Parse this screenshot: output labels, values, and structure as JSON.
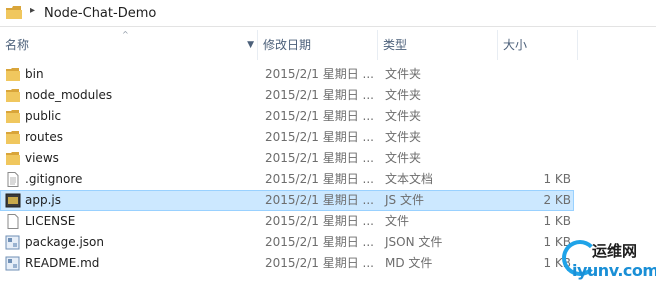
{
  "address": {
    "separator": "▸",
    "crumb": "Node-Chat-Demo"
  },
  "columns": {
    "name": "名称",
    "date": "修改日期",
    "type": "类型",
    "size": "大小",
    "sort_arrow": "^",
    "dropdown_arrow": "▼"
  },
  "files": [
    {
      "name": "bin",
      "date": "2015/2/1 星期日 ...",
      "type": "文件夹",
      "size": "",
      "icon": "folder-icon"
    },
    {
      "name": "node_modules",
      "date": "2015/2/1 星期日 ...",
      "type": "文件夹",
      "size": "",
      "icon": "folder-icon"
    },
    {
      "name": "public",
      "date": "2015/2/1 星期日 ...",
      "type": "文件夹",
      "size": "",
      "icon": "folder-icon"
    },
    {
      "name": "routes",
      "date": "2015/2/1 星期日 ...",
      "type": "文件夹",
      "size": "",
      "icon": "folder-icon"
    },
    {
      "name": "views",
      "date": "2015/2/1 星期日 ...",
      "type": "文件夹",
      "size": "",
      "icon": "folder-icon"
    },
    {
      "name": ".gitignore",
      "date": "2015/2/1 星期日 ...",
      "type": "文本文档",
      "size": "1 KB",
      "icon": "text-file-icon"
    },
    {
      "name": "app.js",
      "date": "2015/2/1 星期日 ...",
      "type": "JS 文件",
      "size": "2 KB",
      "icon": "script-file-icon",
      "selected": true
    },
    {
      "name": "LICENSE",
      "date": "2015/2/1 星期日 ...",
      "type": "文件",
      "size": "1 KB",
      "icon": "blank-file-icon"
    },
    {
      "name": "package.json",
      "date": "2015/2/1 星期日 ...",
      "type": "JSON 文件",
      "size": "1 KB",
      "icon": "json-file-icon"
    },
    {
      "name": "README.md",
      "date": "2015/2/1 星期日 ...",
      "type": "MD 文件",
      "size": "1 KB",
      "icon": "json-file-icon"
    }
  ],
  "watermark": {
    "top": "运维网",
    "bottom": "iyunv.com"
  },
  "colors": {
    "folder": "#e8b84a",
    "selected_bg": "#cce8ff",
    "selected_border": "#99d1ff",
    "header_text": "#4c607a"
  }
}
